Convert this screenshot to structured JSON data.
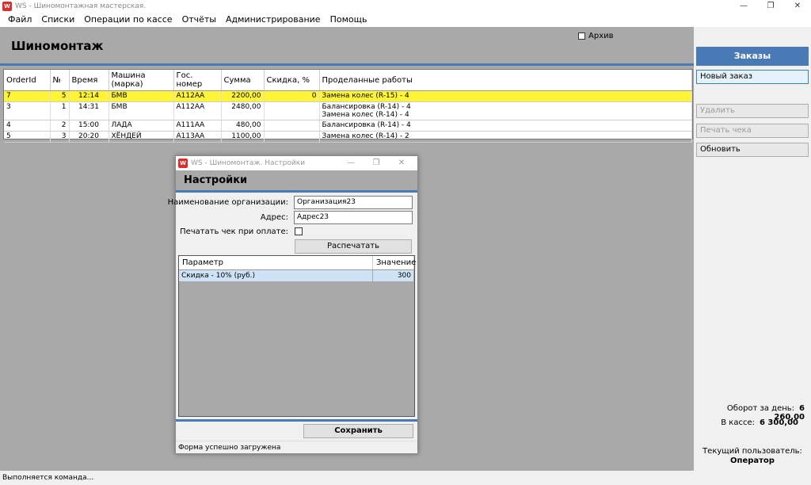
{
  "window": {
    "title": "WS - Шиномонтажная мастерская.",
    "icon_text": "W",
    "controls": [
      "—",
      "❐",
      "✕"
    ]
  },
  "menu": [
    "Файл",
    "Списки",
    "Операции по кассе",
    "Отчёты",
    "Администрирование",
    "Помощь"
  ],
  "header": {
    "title": "Шиномонтаж",
    "archive_label": "Архив",
    "archive_checked": false
  },
  "orders": {
    "columns": [
      "OrderId",
      "№",
      "Время",
      "Машина (марка)",
      "Гос. номер",
      "Сумма",
      "Скидка, %",
      "Проделанные работы"
    ],
    "rows": [
      {
        "id": "7",
        "num": "5",
        "time": "12:14",
        "car": "БМВ",
        "plate": "А112АА",
        "sum": "2200,00",
        "discount": "0",
        "works": [
          "Замена колес (R-15) - 4"
        ],
        "selected": true
      },
      {
        "id": "3",
        "num": "1",
        "time": "14:31",
        "car": "БМВ",
        "plate": "А112АА",
        "sum": "2480,00",
        "discount": "",
        "works": [
          "Балансировка (R-14) - 4",
          "Замена колес (R-14) - 4"
        ],
        "selected": false
      },
      {
        "id": "4",
        "num": "2",
        "time": "15:00",
        "car": "ЛАДА",
        "plate": "А111АА",
        "sum": "480,00",
        "discount": "",
        "works": [
          "Балансировка (R-14) - 4"
        ],
        "selected": false
      },
      {
        "id": "5",
        "num": "3",
        "time": "20:20",
        "car": "ХЁНДЕЙ",
        "plate": "А113АА",
        "sum": "1100,00",
        "discount": "",
        "works": [
          "Замена колес (R-14) - 2"
        ],
        "selected": false
      }
    ]
  },
  "right_panel": {
    "header": "Заказы",
    "new_order": "Новый заказ",
    "delete": "Удалить",
    "print_receipt": "Печать чека",
    "refresh": "Обновить",
    "turnover_label": "Оборот за день:",
    "turnover_value": "6 260,00",
    "cash_label": "В кассе:",
    "cash_value": "6 300,00",
    "user_label": "Текущий пользователь:",
    "user_value": "Оператор"
  },
  "status": "Выполняется команда...",
  "dialog": {
    "title": "WS - Шиномонтаж. Настройки",
    "heading": "Настройки",
    "org_label": "Наименование организации:",
    "org_value": "Организация23",
    "address_label": "Адрес:",
    "address_value": "Адрес23",
    "print_on_pay_label": "Печатать чек при оплате:",
    "print_on_pay_checked": false,
    "print_button": "Распечатать",
    "params": {
      "columns": [
        "Параметр",
        "Значение"
      ],
      "rows": [
        {
          "name": "Скидка - 10% (руб.)",
          "value": "300"
        }
      ]
    },
    "save_button": "Сохранить",
    "status": "Форма успешно загружена"
  }
}
